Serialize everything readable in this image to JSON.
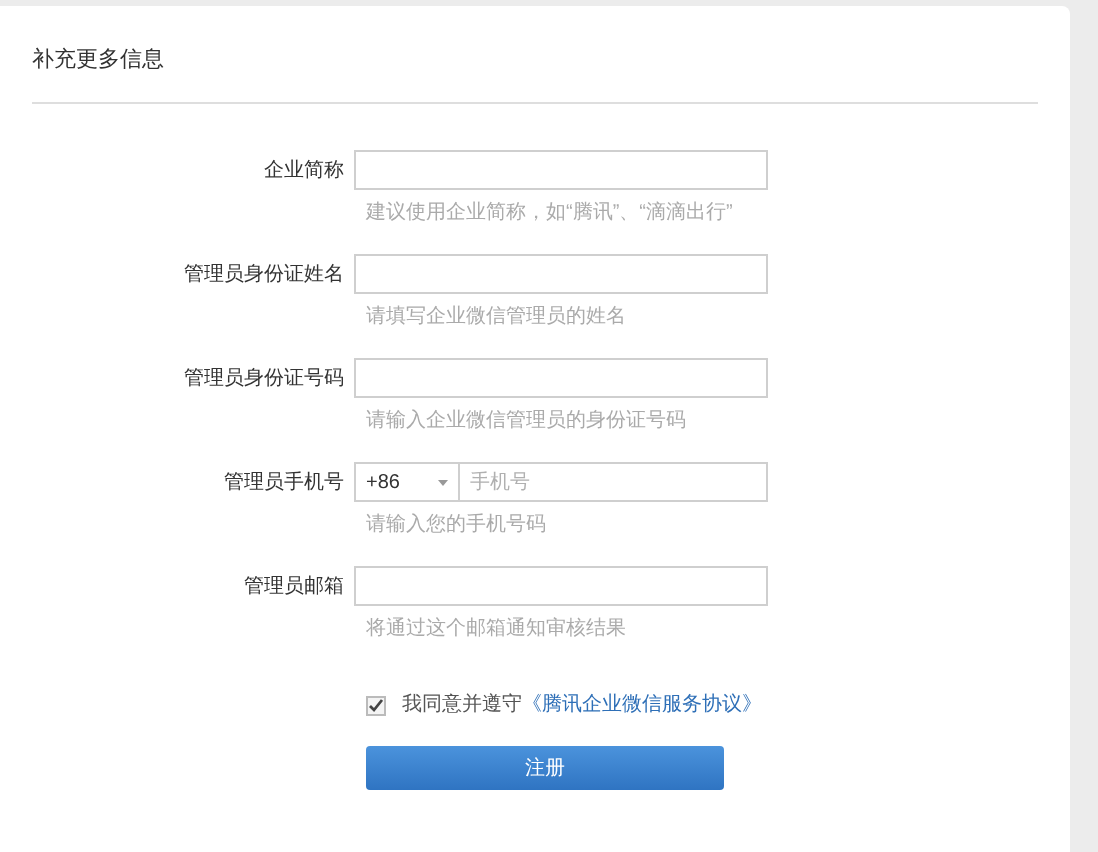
{
  "title": "补充更多信息",
  "fields": [
    {
      "kind": "text",
      "label": "企业简称",
      "hint": "建议使用企业简称，如“腾讯”、“滴滴出行”"
    },
    {
      "kind": "text",
      "label": "管理员身份证姓名",
      "hint": "请填写企业微信管理员的姓名"
    },
    {
      "kind": "text",
      "label": "管理员身份证号码",
      "hint": "请输入企业微信管理员的身份证号码"
    },
    {
      "kind": "phone",
      "label": "管理员手机号",
      "country_code": "+86",
      "placeholder": "手机号",
      "hint": "请输入您的手机号码"
    },
    {
      "kind": "text",
      "label": "管理员邮箱",
      "hint": "将通过这个邮箱通知审核结果"
    }
  ],
  "agreement": {
    "checked": true,
    "text": "我同意并遵守",
    "link": "《腾讯企业微信服务协议》"
  },
  "submit": "注册"
}
